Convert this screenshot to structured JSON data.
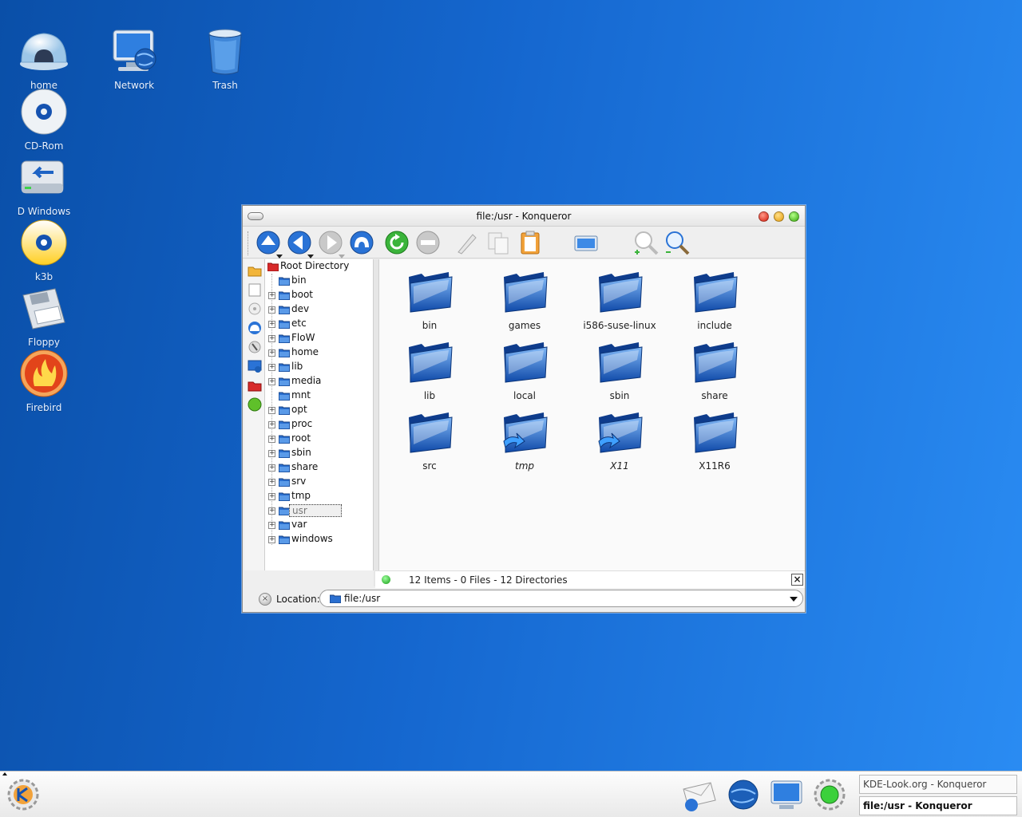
{
  "desktop": {
    "icons": [
      {
        "label": "home",
        "icon": "home-dome-icon"
      },
      {
        "label": "Network",
        "icon": "network-monitor-icon"
      },
      {
        "label": "Trash",
        "icon": "trash-icon"
      },
      {
        "label": "CD-Rom",
        "icon": "cdrom-icon"
      },
      {
        "label": "D Windows",
        "icon": "drive-icon"
      },
      {
        "label": "k3b",
        "icon": "k3b-disc-icon"
      },
      {
        "label": "Floppy",
        "icon": "floppy-icon"
      },
      {
        "label": "Firebird",
        "icon": "firebird-icon"
      }
    ]
  },
  "window": {
    "title": "file:/usr - Konqueror",
    "toolbar": [
      "up-icon",
      "back-icon",
      "forward-icon",
      "home-icon",
      "reload-icon",
      "stop-icon",
      "cut-icon",
      "copy-icon",
      "paste-icon",
      "print-icon",
      "zoom-in-icon",
      "zoom-out-icon"
    ],
    "tree": {
      "root": "Root Directory",
      "items": [
        "bin",
        "boot",
        "dev",
        "etc",
        "FloW",
        "home",
        "lib",
        "media",
        "mnt",
        "opt",
        "proc",
        "root",
        "sbin",
        "share",
        "srv",
        "tmp",
        "usr",
        "var",
        "windows"
      ],
      "selected": "usr"
    },
    "files": [
      {
        "name": "bin",
        "link": false
      },
      {
        "name": "games",
        "link": false
      },
      {
        "name": "i586-suse-linux",
        "link": false
      },
      {
        "name": "include",
        "link": false
      },
      {
        "name": "lib",
        "link": false
      },
      {
        "name": "local",
        "link": false
      },
      {
        "name": "sbin",
        "link": false
      },
      {
        "name": "share",
        "link": false
      },
      {
        "name": "src",
        "link": false
      },
      {
        "name": "tmp",
        "link": true
      },
      {
        "name": "X11",
        "link": true
      },
      {
        "name": "X11R6",
        "link": false
      }
    ],
    "status": "12 Items - 0 Files - 12 Directories",
    "location_label": "Location:",
    "location_value": "file:/usr"
  },
  "taskbar": {
    "tasks": [
      {
        "label": "KDE-Look.org - Konqueror",
        "active": false
      },
      {
        "label": "file:/usr - Konqueror",
        "active": true
      }
    ]
  }
}
